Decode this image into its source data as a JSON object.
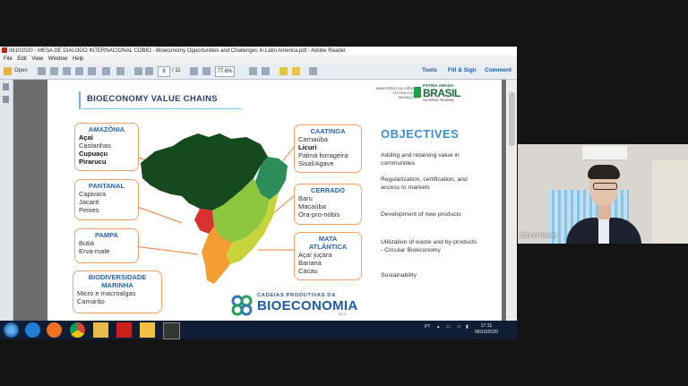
{
  "window": {
    "title": "06102020 - MESA DE DIALOGO INTERNACIONAL COBIO - Bioeconomy Opportunities and Challenges in Latin America.pdf - Adobe Reader"
  },
  "menu": [
    "File",
    "Edit",
    "View",
    "Window",
    "Help"
  ],
  "toolbar": {
    "open_label": "Open",
    "page_current": "9",
    "page_total": "/ 11",
    "zoom": "77.6%",
    "tools_label": "Tools",
    "fill_sign_label": "Fill & Sign",
    "comment_label": "Comment"
  },
  "slide": {
    "title": "BIOECONOMY VALUE CHAINS",
    "ministry": "MINISTÉRIO DA CIÊNCIA, TECNOLOGIA E INOVAÇÕES",
    "logo_top": "PÁTRIA AMADA",
    "logo_main": "BRASIL",
    "logo_sub": "GOVERNO FEDERAL",
    "regions": {
      "amazonia": {
        "name": "AMAZÔNIA",
        "items": [
          {
            "t": "Açaí",
            "b": true
          },
          {
            "t": "Castanhas",
            "b": false
          },
          {
            "t": "Cupuaçu",
            "b": true
          },
          {
            "t": "Pirarucu",
            "b": true
          }
        ]
      },
      "pantanal": {
        "name": "PANTANAL",
        "items": [
          "Capivara",
          "Jacaré",
          "Peixes"
        ]
      },
      "pampa": {
        "name": "PAMPA",
        "items": [
          "Butiá",
          "Erva-mate"
        ]
      },
      "marinha": {
        "name1": "BIODIVERSIDADE",
        "name2": "MARINHA",
        "items": [
          "Micro e macroalgas",
          "Camarão"
        ]
      },
      "caatinga": {
        "name": "CAATINGA",
        "items": [
          {
            "t": "Carnaúba",
            "b": false
          },
          {
            "t": "Licuri",
            "b": true
          },
          {
            "t": "Palma forrageira",
            "b": false
          },
          {
            "t": "Sisal/Agave",
            "b": false
          }
        ]
      },
      "cerrado": {
        "name": "CERRADO",
        "items": [
          "Baru",
          "Macaúba",
          "Ora-pro-nóbis"
        ]
      },
      "mata": {
        "name1": "MATA",
        "name2": "ATLÂNTICA",
        "items": [
          "Açaí juçara",
          "Banana",
          "Cacau"
        ]
      }
    },
    "objectives_title": "OBJECTIVES",
    "objectives": [
      "Adding and retaining value in communities",
      "Regularization, certification, and access to markets",
      "Development of new products",
      "Utilization of waste and by-products - Circular Bioeconomy",
      "Sustainability"
    ],
    "footer_logo_top": "CADEIAS PRODUTIVAS DA",
    "footer_logo_main": "BIOECONOMIA",
    "footer_logo_sub": "MCTI"
  },
  "taskbar": {
    "lang": "PT",
    "time": "17:11",
    "date": "06/10/2020"
  },
  "participant": {
    "name": "Bruno Nunes"
  },
  "colors": {
    "accent_blue": "#3d8fd7",
    "box_border": "#f0a36a",
    "taskbar": "#0e1d33"
  }
}
